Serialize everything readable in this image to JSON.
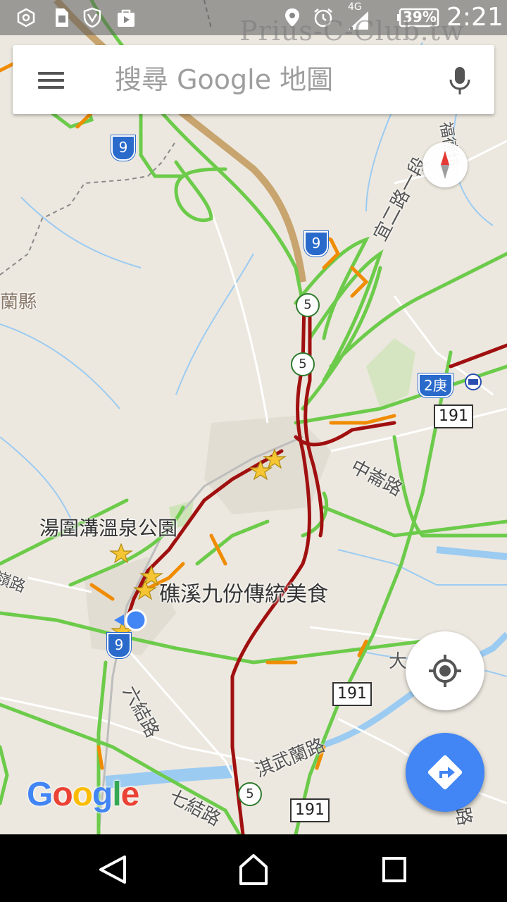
{
  "status_bar": {
    "network": "4G",
    "battery": "39%",
    "time": "2:21",
    "icons": [
      "camera-settings-icon",
      "sim-icon",
      "shield-icon",
      "store-bag-icon",
      "location-pin-icon",
      "alarm-icon",
      "signal-icon",
      "battery-icon"
    ]
  },
  "watermark": "Prius-C-Club.tw",
  "search": {
    "placeholder": "搜尋 Google 地圖",
    "menu_icon": "hamburger-menu-icon",
    "mic_icon": "microphone-icon"
  },
  "map": {
    "labels": {
      "hot_spring_park": "湯圍溝溫泉公園",
      "jiaoxi_food": "礁溪九份傳統美食",
      "county": "蘭縣",
      "ling_road": "嶺路"
    },
    "road_names": {
      "yi_er_road": "宜二路一段",
      "zhongshan_road": "中崙路",
      "liu_jie_road": "六結路",
      "qi_jie_road": "七結路",
      "qi_wu_lan_road": "淇武蘭路",
      "da_partial": "大",
      "fu_de_keng": "福德坑",
      "right_edge_road": "路"
    },
    "shields": {
      "route_9_a": "9",
      "route_9_b": "9",
      "route_9_c": "9",
      "route_5_a": "5",
      "route_5_b": "5",
      "route_5_c": "5",
      "route_191_a": "191",
      "route_191_b": "191",
      "route_191_c": "191",
      "route_2_geng": "2庚"
    },
    "colors": {
      "traffic_heavy": "#a01010",
      "traffic_slow": "#f08c00",
      "traffic_free": "#6ccb4a",
      "water": "#9ccbf2",
      "background": "#ece8df"
    }
  },
  "logo": {
    "letters": [
      "G",
      "o",
      "o",
      "g",
      "l",
      "e"
    ],
    "colors": [
      "#4285f4",
      "#ea4335",
      "#fbbc05",
      "#4285f4",
      "#34a853",
      "#ea4335"
    ]
  },
  "controls": {
    "compass_icon": "compass-icon",
    "my_location_icon": "my-location-icon",
    "directions_icon": "directions-icon"
  },
  "nav_bar": {
    "back_icon": "back-icon",
    "home_icon": "home-icon",
    "recents_icon": "recents-icon"
  }
}
